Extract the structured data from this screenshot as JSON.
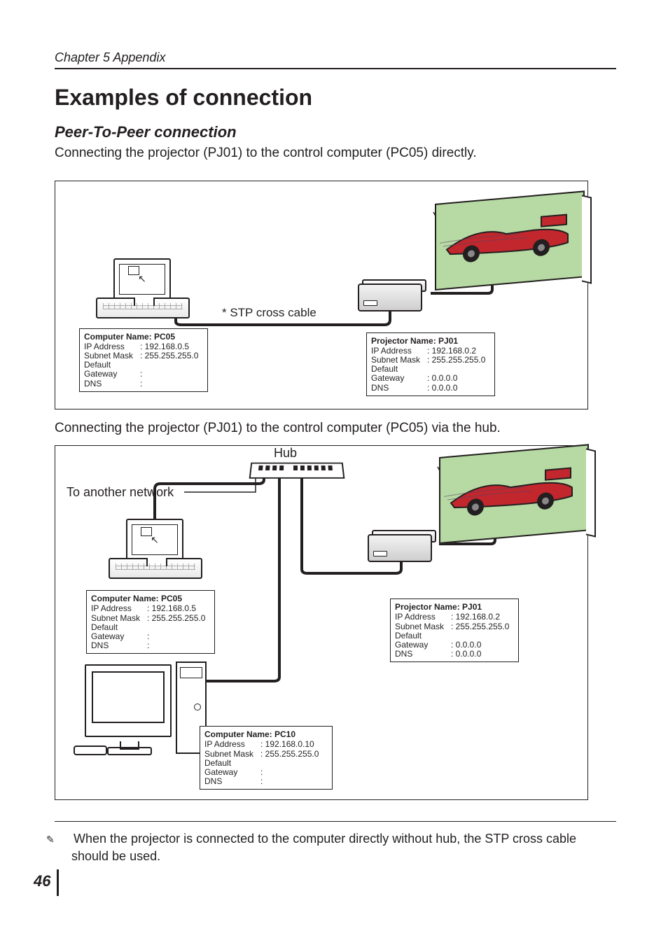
{
  "chapter": "Chapter 5 Appendix",
  "title": "Examples of connection",
  "subheading": "Peer-To-Peer connection",
  "intro1": "Connecting the projector (PJ01) to the control computer (PC05) directly.",
  "intro2": "Connecting the projector (PJ01) to the control computer (PC05) via the hub.",
  "cable_label": "* STP cross cable",
  "hub_label": "Hub",
  "to_network_label": "To another network",
  "footnote": "When the projector is connected to the computer directly without hub, the STP cross cable should be used.",
  "page_number": "46",
  "cards": {
    "pc05": {
      "name": "Computer Name: PC05",
      "rows": [
        {
          "lbl": "IP Address",
          "val": ": 192.168.0.5"
        },
        {
          "lbl": "Subnet Mask",
          "val": ": 255.255.255.0"
        },
        {
          "lbl": "Default Gateway",
          "val": ":"
        },
        {
          "lbl": "DNS",
          "val": ":"
        }
      ]
    },
    "pj01": {
      "name": "Projector Name: PJ01",
      "rows": [
        {
          "lbl": "IP Address",
          "val": ": 192.168.0.2"
        },
        {
          "lbl": "Subnet Mask",
          "val": ": 255.255.255.0"
        },
        {
          "lbl": "Default Gateway",
          "val": ": 0.0.0.0"
        },
        {
          "lbl": "DNS",
          "val": ": 0.0.0.0"
        }
      ]
    },
    "pc10": {
      "name": "Computer Name: PC10",
      "rows": [
        {
          "lbl": "IP Address",
          "val": ": 192.168.0.10"
        },
        {
          "lbl": "Subnet Mask",
          "val": ": 255.255.255.0"
        },
        {
          "lbl": "Default Gateway",
          "val": ":"
        },
        {
          "lbl": "DNS",
          "val": ":"
        }
      ]
    }
  }
}
